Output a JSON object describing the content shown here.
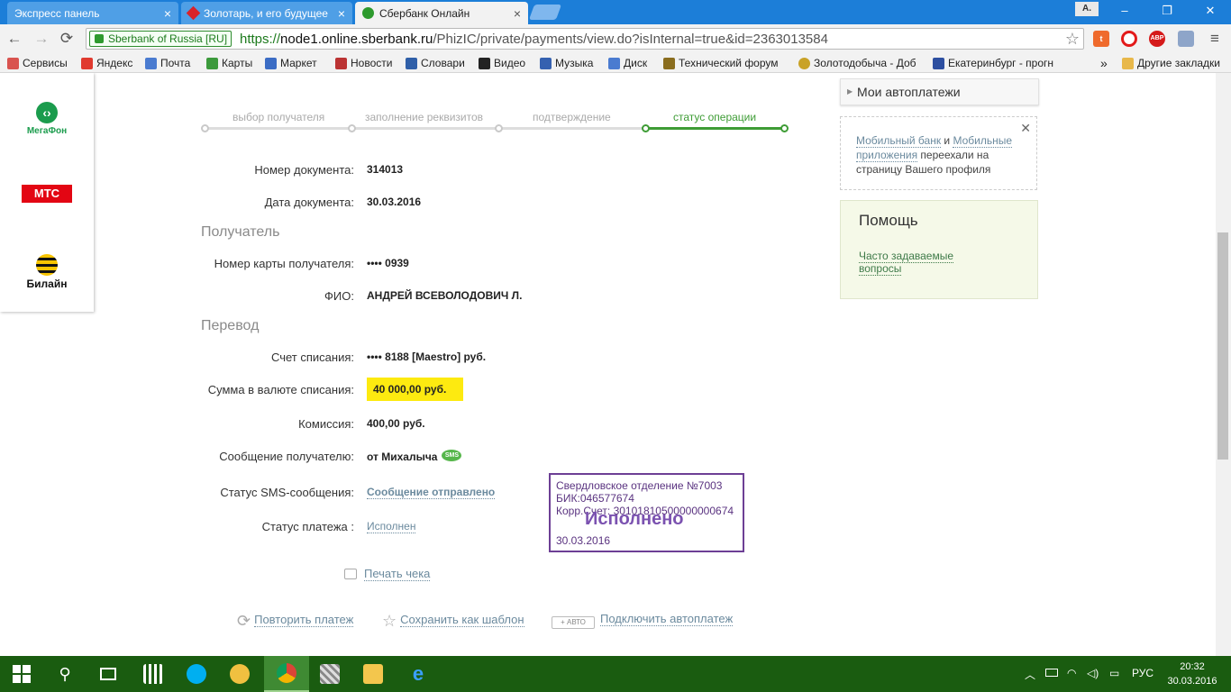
{
  "tabs": [
    {
      "title": "Экспресс панель",
      "active": false
    },
    {
      "title": "Золотарь, и его будущее",
      "active": false
    },
    {
      "title": "Сбербанк Онлайн",
      "active": true
    }
  ],
  "profile": "A.",
  "window": {
    "minimize": "–",
    "restore": "❐",
    "close": "✕"
  },
  "nav": {
    "back": "←",
    "forward": "→",
    "reload": "⟳",
    "ev_badge": "Sberbank of Russia [RU]",
    "url_scheme": "https://",
    "url_host": "node1.online.sberbank.ru",
    "url_path": "/PhizIC/private/payments/view.do?isInternal=true&id=2363013584",
    "star": "☆",
    "menu": "≡",
    "abp": "ABP"
  },
  "bookmarks": [
    {
      "label": "Сервисы",
      "color": "#d9534f"
    },
    {
      "label": "Яндекс",
      "color": "#e03a2f"
    },
    {
      "label": "Почта",
      "color": "#4a7bd0"
    },
    {
      "label": "Карты",
      "color": "#3c9a3c"
    },
    {
      "label": "Маркет",
      "color": "#3b6cc4"
    },
    {
      "label": "Новости",
      "color": "#b33"
    },
    {
      "label": "Словари",
      "color": "#2f5fa8"
    },
    {
      "label": "Видео",
      "color": "#222"
    },
    {
      "label": "Музыка",
      "color": "#3561b0"
    },
    {
      "label": "Диск",
      "color": "#4a7bd0"
    },
    {
      "label": "Технический форум",
      "color": "#8a6d1e"
    },
    {
      "label": "Золотодобыча - Доб",
      "color": "#c9a227"
    },
    {
      "label": "Екатеринбург - прогн",
      "color": "#2d4fa0"
    }
  ],
  "bookmarks_more": "»",
  "other_bookmarks": "Другие закладки",
  "operators": {
    "megafon": "МегаФон",
    "mts": "МТС",
    "beeline": "Билайн"
  },
  "steps": [
    {
      "label": "выбор получателя",
      "active": false
    },
    {
      "label": "заполнение реквизитов",
      "active": false
    },
    {
      "label": "подтверждение",
      "active": false
    },
    {
      "label": "статус операции",
      "active": true
    }
  ],
  "document": {
    "number_label": "Номер документа:",
    "number": "314013",
    "date_label": "Дата документа:",
    "date": "30.03.2016"
  },
  "recipient": {
    "section": "Получатель",
    "card_label": "Номер карты получателя:",
    "card": "•••• 0939",
    "fio_label": "ФИО:",
    "fio": "АНДРЕЙ ВСЕВОЛОДОВИЧ Л."
  },
  "transfer": {
    "section": "Перевод",
    "account_label": "Счет списания:",
    "account": "•••• 8188  [Maestro]  руб.",
    "amount_label": "Сумма в валюте списания:",
    "amount": "40 000,00  руб.",
    "commission_label": "Комиссия:",
    "commission": "400,00 руб.",
    "message_label": "Сообщение получателю:",
    "message": "от Михалыча",
    "sms_badge": "SMS",
    "sms_status_label": "Статус SMS-сообщения:",
    "sms_status": "Сообщение отправлено",
    "payment_status_label": "Статус платежа :",
    "payment_status": "Исполнен"
  },
  "stamp": {
    "line1": "Свердловское отделение №7003",
    "line2": "БИК:046577674",
    "line3": "Корр.Счет: 30101810500000000674",
    "big": "Исполнено",
    "date": "30.03.2016"
  },
  "actions": {
    "print": "Печать чека",
    "repeat": "Повторить платеж",
    "save_template": "Сохранить как шаблон",
    "auto_badge": "+ АВТО",
    "autopay": "Подключить автоплатеж"
  },
  "sidebar": {
    "autopay_title": "Мои автоплатежи",
    "notice_link1": "Мобильный банк",
    "notice_and": " и ",
    "notice_link2": "Мобильные приложения",
    "notice_text": " переехали на страницу Вашего профиля",
    "notice_close": "✕",
    "help_title": "Помощь",
    "help_link": "Часто задаваемые вопросы"
  },
  "taskbar": {
    "lang": "РУС",
    "time": "20:32",
    "date": "30.03.2016"
  },
  "colors": {
    "brand_green": "#3e9c35",
    "highlight": "#fdea10",
    "stamp": "#6d3f95",
    "taskbar": "#1a5c10",
    "chrome_blue": "#1c7ed8"
  }
}
